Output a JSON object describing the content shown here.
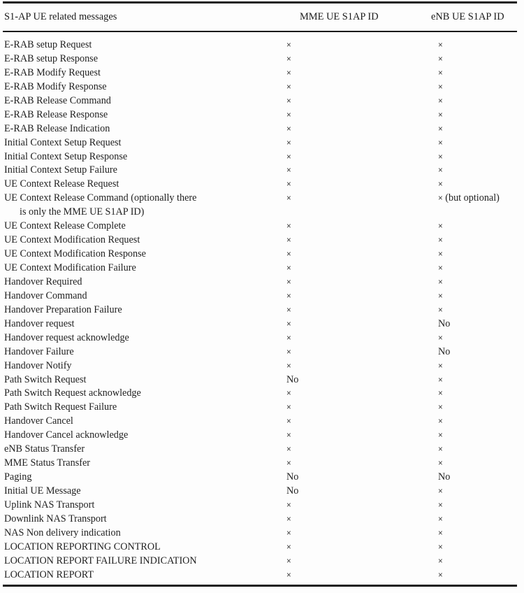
{
  "table": {
    "columns": [
      {
        "key": "message",
        "label": "S1-AP UE related messages"
      },
      {
        "key": "mme",
        "label": "MME UE S1AP ID"
      },
      {
        "key": "enb",
        "label": "eNB UE S1AP ID"
      }
    ],
    "mark_symbol": "×",
    "negative_symbol": "No",
    "rows": [
      {
        "message": "E-RAB setup Request",
        "mme": "×",
        "enb": "×"
      },
      {
        "message": "E-RAB setup Response",
        "mme": "×",
        "enb": "×"
      },
      {
        "message": "E-RAB Modify Request",
        "mme": "×",
        "enb": "×"
      },
      {
        "message": "E-RAB Modify Response",
        "mme": "×",
        "enb": "×"
      },
      {
        "message": "E-RAB Release Command",
        "mme": "×",
        "enb": "×"
      },
      {
        "message": "E-RAB Release Response",
        "mme": "×",
        "enb": "×"
      },
      {
        "message": "E-RAB Release Indication",
        "mme": "×",
        "enb": "×"
      },
      {
        "message": "Initial Context Setup Request",
        "mme": "×",
        "enb": "×"
      },
      {
        "message": "Initial Context Setup Response",
        "mme": "×",
        "enb": "×"
      },
      {
        "message": "Initial Context Setup Failure",
        "mme": "×",
        "enb": "×"
      },
      {
        "message": "UE Context Release Request",
        "mme": "×",
        "enb": "×"
      },
      {
        "message": "UE Context Release Command (optionally there",
        "message_line2": "is only the MME UE S1AP ID)",
        "mme": "×",
        "enb": "× (but optional)",
        "tall": true
      },
      {
        "message": "UE Context Release Complete",
        "mme": "×",
        "enb": "×"
      },
      {
        "message": "UE Context Modification Request",
        "mme": "×",
        "enb": "×"
      },
      {
        "message": "UE Context Modification Response",
        "mme": "×",
        "enb": "×"
      },
      {
        "message": "UE Context Modification Failure",
        "mme": "×",
        "enb": "×"
      },
      {
        "message": "Handover Required",
        "mme": "×",
        "enb": "×"
      },
      {
        "message": "Handover Command",
        "mme": "×",
        "enb": "×"
      },
      {
        "message": "Handover Preparation Failure",
        "mme": "×",
        "enb": "×"
      },
      {
        "message": "Handover request",
        "mme": "×",
        "enb": "No"
      },
      {
        "message": "Handover request acknowledge",
        "mme": "×",
        "enb": "×"
      },
      {
        "message": "Handover Failure",
        "mme": "×",
        "enb": "No"
      },
      {
        "message": "Handover Notify",
        "mme": "×",
        "enb": "×"
      },
      {
        "message": "Path Switch Request",
        "mme": "No",
        "enb": "×"
      },
      {
        "message": "Path Switch Request acknowledge",
        "mme": "×",
        "enb": "×"
      },
      {
        "message": "Path Switch Request Failure",
        "mme": "×",
        "enb": "×"
      },
      {
        "message": "Handover Cancel",
        "mme": "×",
        "enb": "×"
      },
      {
        "message": "Handover Cancel acknowledge",
        "mme": "×",
        "enb": "×"
      },
      {
        "message": "eNB Status Transfer",
        "mme": "×",
        "enb": "×"
      },
      {
        "message": "MME Status Transfer",
        "mme": "×",
        "enb": "×"
      },
      {
        "message": "Paging",
        "mme": "No",
        "enb": "No"
      },
      {
        "message": "Initial UE Message",
        "mme": "No",
        "enb": "×"
      },
      {
        "message": "Uplink NAS Transport",
        "mme": "×",
        "enb": "×"
      },
      {
        "message": "Downlink NAS Transport",
        "mme": "×",
        "enb": "×"
      },
      {
        "message": "NAS Non delivery indication",
        "mme": "×",
        "enb": "×"
      },
      {
        "message": "LOCATION REPORTING CONTROL",
        "mme": "×",
        "enb": "×"
      },
      {
        "message": "LOCATION REPORT FAILURE INDICATION",
        "mme": "×",
        "enb": "×"
      },
      {
        "message": "LOCATION REPORT",
        "mme": "×",
        "enb": "×"
      }
    ]
  }
}
